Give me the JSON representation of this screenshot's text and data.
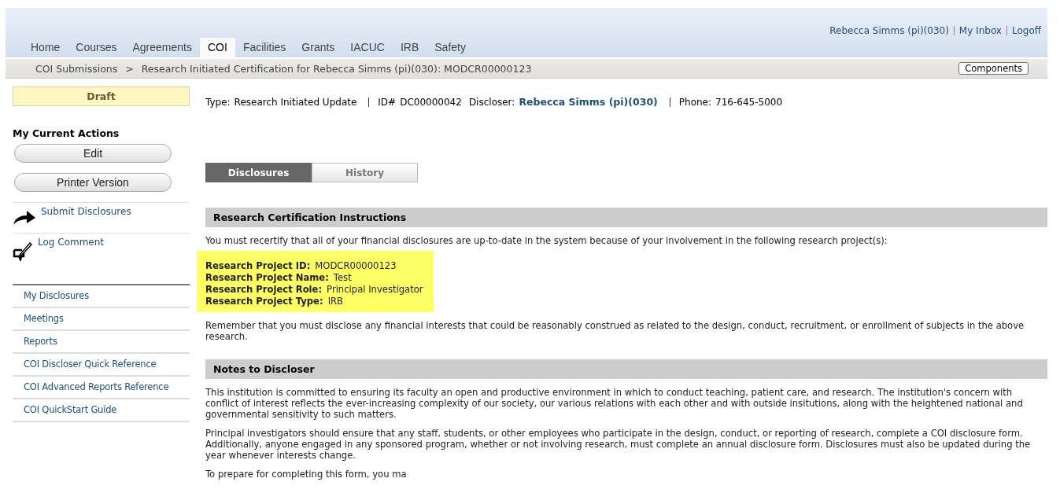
{
  "header": {
    "user_links": [
      "Rebecca Simms (pi)(030)",
      "My Inbox",
      "Logoff"
    ],
    "nav_tabs": [
      {
        "label": "Home",
        "selected": false
      },
      {
        "label": "Courses",
        "selected": false
      },
      {
        "label": "Agreements",
        "selected": false
      },
      {
        "label": "COI",
        "selected": true
      },
      {
        "label": "Facilities",
        "selected": false
      },
      {
        "label": "Grants",
        "selected": false
      },
      {
        "label": "IACUC",
        "selected": false
      },
      {
        "label": "IRB",
        "selected": false
      },
      {
        "label": "Safety",
        "selected": false
      }
    ]
  },
  "breadcrumb": {
    "items": [
      "COI Submissions",
      "Research Initiated Certification for Rebecca Simms (pi)(030): MODCR00000123"
    ],
    "separator": ">",
    "button": "Components"
  },
  "sidebar": {
    "status": "Draft",
    "actions_title": "My Current Actions",
    "buttons": [
      "Edit",
      "Printer Version"
    ],
    "activities": [
      {
        "kind": "submit",
        "label": "Submit Disclosures"
      },
      {
        "kind": "comment",
        "label": "Log Comment"
      }
    ],
    "links": [
      "My Disclosures",
      "Meetings",
      "Reports",
      "COI Discloser Quick Reference",
      "COI Advanced Reports Reference",
      "COI QuickStart Guide"
    ]
  },
  "summary": [
    {
      "label": "Type:",
      "value": "Research Initiated Update",
      "emphasis": false
    },
    {
      "label": "ID#",
      "value": "DC00000042",
      "emphasis": false
    },
    {
      "label": "Discloser:",
      "value": "Rebecca Simms (pi)(030)",
      "emphasis": true
    },
    {
      "label": "Phone:",
      "value": "716-645-5000",
      "emphasis": false
    }
  ],
  "content_tabs": [
    {
      "label": "Disclosures",
      "selected": true
    },
    {
      "label": "History",
      "selected": false
    }
  ],
  "instructions": {
    "heading": "Research Certification Instructions",
    "intro": "You must recertify that all of your financial disclosures are up-to-date in the system because of your involvement in the following research project(s):",
    "project": [
      {
        "label": "Research Project ID:",
        "value": "MODCR00000123"
      },
      {
        "label": "Research Project Name:",
        "value": "Test"
      },
      {
        "label": "Research Project Role:",
        "value": "Principal Investigator"
      },
      {
        "label": "Research Project Type:",
        "value": "IRB"
      }
    ],
    "note": "Remember that you must disclose any financial interests that could be reasonably construed as related to the design, conduct, recruitment, or enrollment of subjects in the above research."
  },
  "notes": {
    "heading": "Notes to Discloser",
    "paragraphs": [
      "This institution is committed to ensuring its faculty an open and productive environment in which to conduct teaching, patient care, and research.  The institution's concern with conflict of interest reflects the ever-increasing complexity of our society, our various relations with each other and with outside insitutions, along with the heightened national and governmental sensitivity to such matters.",
      "Principal investigators should ensure that any staff, students, or other employees who participate in the design, conduct, or reporting of research, complete a COI disclosure form.  Additionally, anyone engaged in any sponsored program, whether or not involving research, must complete an annual disclosure form.  Disclosures must also be updated during the year whenever interests change.",
      "To prepare for completing this form, you ma"
    ]
  }
}
